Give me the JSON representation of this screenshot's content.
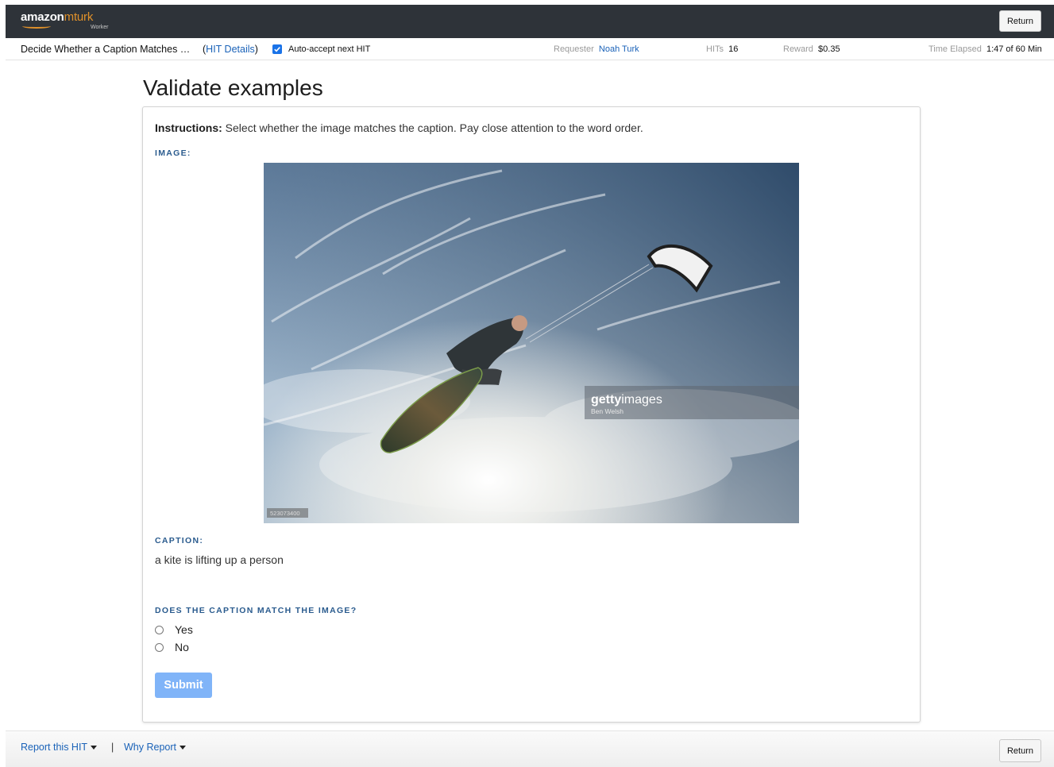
{
  "header": {
    "logo_brand": "amazon",
    "logo_product": "mturk",
    "logo_sub": "Worker",
    "return_label": "Return"
  },
  "hit_bar": {
    "title": "Decide Whether a Caption Matches …",
    "details_open": "(",
    "details_link": "HIT Details",
    "details_close": ")",
    "auto_accept_label": "Auto-accept next HIT",
    "auto_accept_checked": true,
    "requester_label": "Requester",
    "requester_value": "Noah Turk",
    "hits_label": "HITs",
    "hits_value": "16",
    "reward_label": "Reward",
    "reward_value": "$0.35",
    "time_label": "Time Elapsed",
    "time_value": "1:47 of 60 Min"
  },
  "main": {
    "heading": "Validate examples",
    "instructions_bold": "Instructions:",
    "instructions_text": " Select whether the image matches the caption. Pay close attention to the word order.",
    "image_label": "IMAGE:",
    "watermark_brand": "getty",
    "watermark_brand2": "images",
    "watermark_credit": "Ben Welsh",
    "image_id": "523073400",
    "caption_label": "CAPTION:",
    "caption_text": "a kite is lifting up a person",
    "question_label": "DOES THE CAPTION MATCH THE IMAGE?",
    "options": [
      "Yes",
      "No"
    ],
    "submit_label": "Submit"
  },
  "footer": {
    "report_hit": "Report this HIT",
    "separator": "|",
    "why_report": "Why Report",
    "return_label": "Return"
  },
  "colors": {
    "topbar": "#2e3339",
    "accent_orange": "#e0912a",
    "link_blue": "#1a62b8",
    "section_label": "#2a5b8e",
    "submit_disabled": "#80b4f8"
  }
}
